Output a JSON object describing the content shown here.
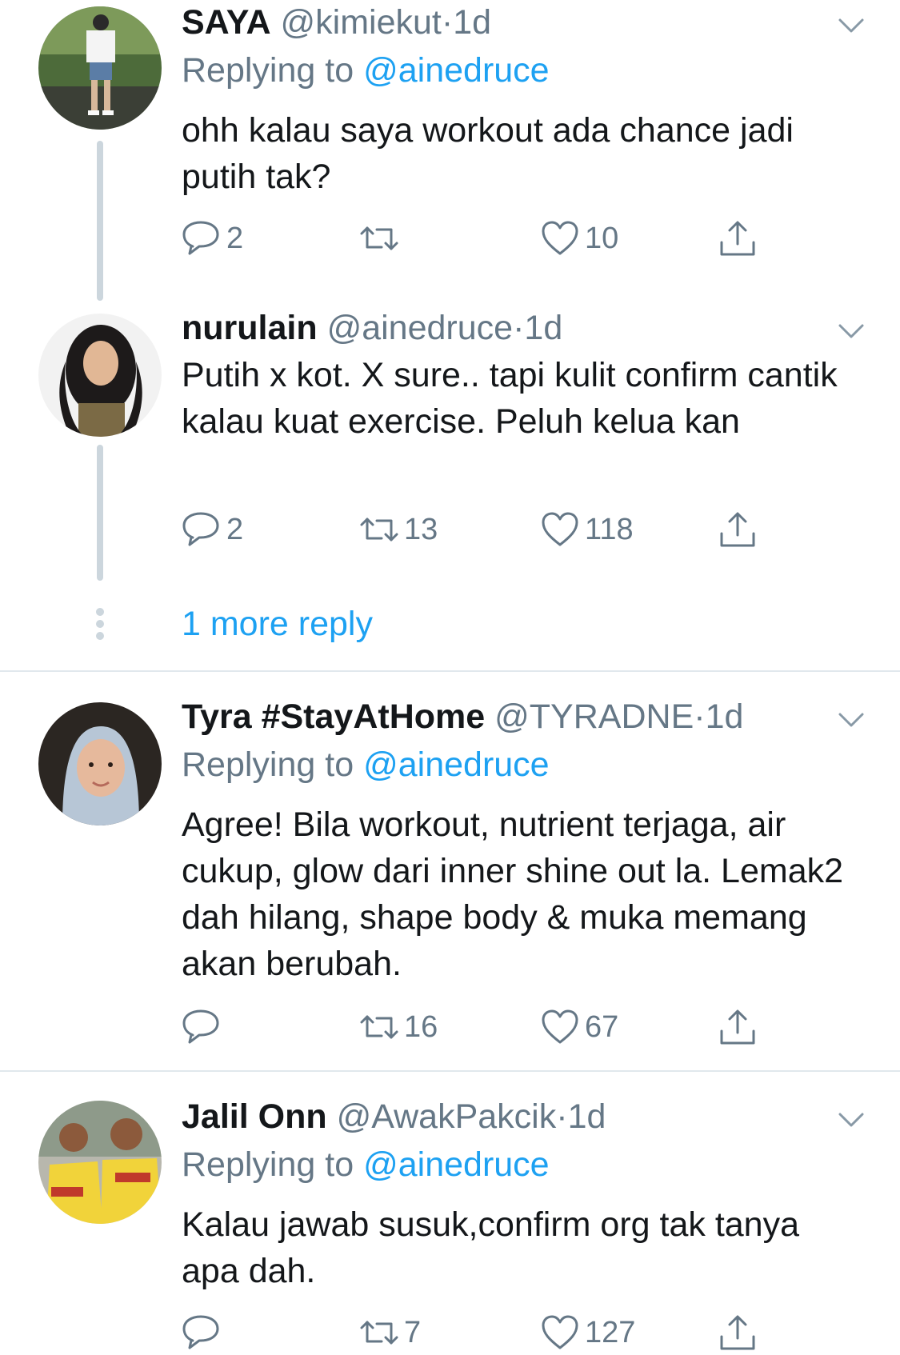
{
  "tweets": [
    {
      "name": "SAYA",
      "handle": "@kimiekut",
      "separator": "·",
      "time": "1d",
      "replying_prefix": "Replying to ",
      "replying_to": "@ainedruce",
      "text": "ohh kalau saya workout ada chance jadi putih tak?",
      "replies": "2",
      "retweets": "",
      "likes": "10"
    },
    {
      "name": "nurulain",
      "handle": "@ainedruce",
      "separator": "·",
      "time": "1d",
      "text": "Putih x kot. X sure.. tapi kulit confirm cantik kalau kuat exercise. Peluh kelua kan",
      "replies": "2",
      "retweets": "13",
      "likes": "118"
    },
    {
      "name": "Tyra #StayAtHome",
      "handle": "@TYRADNE",
      "separator": "·",
      "time": "1d",
      "replying_prefix": "Replying to ",
      "replying_to": "@ainedruce",
      "text": "Agree! Bila workout, nutrient terjaga, air cukup, glow dari inner shine out la. Lemak2 dah hilang, shape body & muka memang akan berubah.",
      "replies": "",
      "retweets": "16",
      "likes": "67"
    },
    {
      "name": "Jalil Onn",
      "handle": "@AwakPakcik",
      "separator": "·",
      "time": "1d",
      "replying_prefix": "Replying to ",
      "replying_to": "@ainedruce",
      "text": "Kalau jawab susuk,confirm org tak tanya apa dah.",
      "replies": "",
      "retweets": "7",
      "likes": "127"
    }
  ],
  "thread": {
    "more_replies_label": "1 more reply"
  },
  "icons": {
    "reply": "reply-icon",
    "retweet": "retweet-icon",
    "like": "heart-icon",
    "share": "share-icon",
    "caret": "chevron-down-icon"
  },
  "colors": {
    "text_primary": "#14171a",
    "text_secondary": "#657786",
    "link": "#1da1f2",
    "thread_line": "#ccd6dd",
    "divider": "#e1e8ed"
  }
}
